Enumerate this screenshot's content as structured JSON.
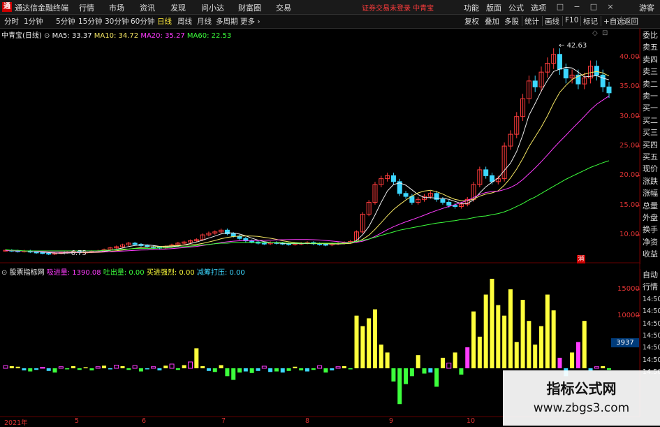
{
  "window": {
    "logo_char": "通",
    "title": "通达信金融终端",
    "menu": [
      "行情",
      "市场",
      "资讯",
      "发现",
      "问小达",
      "财富圈",
      "交易"
    ],
    "notice": "证券交易未登录 中青宝",
    "right_menu": [
      "功能",
      "版面",
      "公式",
      "选项"
    ],
    "guest": "游客",
    "controls": [
      "□",
      "−",
      "□",
      "×"
    ]
  },
  "toolbar": {
    "periods": [
      "分时",
      "1分钟",
      "5分钟",
      "15分钟",
      "30分钟",
      "60分钟",
      "日线",
      "周线",
      "月线",
      "多周期",
      "更多"
    ],
    "active_period": "日线",
    "right_buttons": [
      "复权",
      "叠加",
      "多股",
      "统计",
      "画线",
      "F10",
      "标记",
      "+自选",
      "返回"
    ]
  },
  "price_legend": {
    "stock": "中青宝(日线)",
    "ma5": "MA5: 33.37",
    "ma10": "MA10: 34.72",
    "ma20": "MA20: 35.27",
    "ma60": "MA60: 22.53"
  },
  "indicator_legend": {
    "name": "股票指标网",
    "inflow": "吸进量: 1390.08",
    "outflow": "吐出量: 0.00",
    "strong": "买进强烈: 0.00",
    "reduce": "减筹打压: 0.00"
  },
  "annotations": {
    "high": "42.63",
    "low": "6.75",
    "marker": "消"
  },
  "right_panel_top": [
    "委比",
    "卖五",
    "卖四",
    "卖三",
    "卖二",
    "卖一",
    "买一",
    "买二",
    "买三",
    "买四",
    "买五",
    "现价",
    "涨跌",
    "涨幅",
    "总量",
    "外盘",
    "换手",
    "净资",
    "收益"
  ],
  "right_panel_bottom": [
    "自动",
    "行情",
    "14:50",
    "14:50",
    "14:50",
    "14:50",
    "14:50",
    "14:50",
    "14:50"
  ],
  "price_axis": [
    "40.00",
    "35.00",
    "30.00",
    "25.00",
    "20.00",
    "15.00",
    "10.00"
  ],
  "vol_axis": [
    "15000",
    "10000"
  ],
  "vol_badge": "3937",
  "dates": [
    "2021年",
    "5",
    "6",
    "7",
    "8",
    "9",
    "10"
  ],
  "watermark": {
    "line1": "指标公式网",
    "line2": "www.zbgs3.com"
  },
  "chart_data": {
    "type": "line",
    "title": "",
    "price_range": [
      5,
      44
    ],
    "volume_range": [
      -7000,
      17500
    ],
    "close": [
      7.4,
      7.3,
      7.2,
      7.3,
      7.1,
      7.0,
      6.9,
      6.75,
      6.9,
      7.0,
      7.1,
      7.2,
      7.0,
      7.1,
      7.2,
      7.3,
      7.5,
      7.8,
      8.0,
      8.3,
      8.6,
      8.4,
      8.2,
      8.0,
      7.9,
      7.8,
      8.0,
      8.3,
      8.6,
      8.8,
      9.0,
      9.2,
      10.0,
      10.3,
      10.5,
      10.8,
      10.2,
      9.8,
      9.4,
      9.0,
      8.8,
      8.6,
      8.5,
      8.7,
      8.6,
      8.5,
      8.4,
      8.5,
      8.6,
      8.7,
      8.5,
      8.4,
      8.3,
      8.5,
      8.6,
      8.7,
      8.9,
      10.5,
      13.5,
      15.5,
      18.5,
      19.5,
      20.0,
      19.0,
      17.0,
      16.5,
      15.5,
      16.0,
      16.5,
      17.0,
      16.0,
      15.5,
      15.0,
      14.8,
      15.2,
      16.0,
      18.5,
      21.0,
      20.0,
      19.0,
      19.5,
      25.0,
      27.0,
      30.0,
      33.0,
      36.0,
      35.0,
      37.5,
      39.0,
      40.5,
      38.0,
      36.5,
      37.0,
      35.5,
      36.5,
      38.5,
      37.0,
      35.0,
      34.0
    ],
    "ma60": [
      7.5,
      7.4,
      7.4,
      7.3,
      7.3,
      7.3,
      7.3,
      7.3,
      7.3,
      7.3,
      7.3,
      7.3,
      7.3,
      7.3,
      7.3,
      7.3,
      7.4,
      7.4,
      7.5,
      7.6,
      7.6,
      7.7,
      7.7,
      7.7,
      7.7,
      7.8,
      7.8,
      7.9,
      8.0,
      8.0,
      8.1,
      8.2,
      8.3,
      8.4,
      8.5,
      8.6,
      8.6,
      8.7,
      8.7,
      8.7,
      8.7,
      8.7,
      8.7,
      8.7,
      8.7,
      8.7,
      8.6,
      8.6,
      8.6,
      8.6,
      8.6,
      8.6,
      8.6,
      8.6,
      8.6,
      8.6,
      8.7,
      8.9,
      9.1,
      9.3,
      9.6,
      9.9,
      10.2,
      10.5,
      10.8,
      11.0,
      11.2,
      11.4,
      11.6,
      11.8,
      12.0,
      12.1,
      12.3,
      12.4,
      12.6,
      12.7,
      12.9,
      13.1,
      13.2,
      13.4,
      13.6,
      13.9,
      14.3,
      14.8,
      15.3,
      15.9,
      16.4,
      17.0,
      17.6,
      18.2,
      18.8,
      19.4,
      19.9,
      20.4,
      20.9,
      21.4,
      21.8,
      22.2,
      22.53
    ],
    "volume": [
      500,
      400,
      300,
      -400,
      -600,
      -300,
      200,
      -500,
      -800,
      300,
      -200,
      400,
      -300,
      200,
      -400,
      300,
      500,
      -200,
      600,
      400,
      -300,
      500,
      -600,
      -200,
      300,
      -400,
      500,
      800,
      -300,
      600,
      1200,
      3800,
      400,
      -500,
      -700,
      600,
      -1500,
      -2200,
      -800,
      -600,
      -900,
      -500,
      400,
      -700,
      -600,
      -800,
      -500,
      300,
      -400,
      -600,
      -300,
      500,
      -800,
      -400,
      300,
      400,
      -200,
      10000,
      8000,
      9500,
      11200,
      4500,
      3000,
      -2500,
      -6800,
      -3000,
      -1500,
      2500,
      -1000,
      -800,
      -3500,
      2000,
      1000,
      3000,
      -1200,
      4000,
      10800,
      6000,
      14000,
      17000,
      12000,
      10000,
      15000,
      5000,
      13000,
      9000,
      4500,
      8000,
      14000,
      11000,
      2000,
      -1500,
      3000,
      5000,
      9000,
      -500,
      300,
      400,
      -300
    ]
  }
}
